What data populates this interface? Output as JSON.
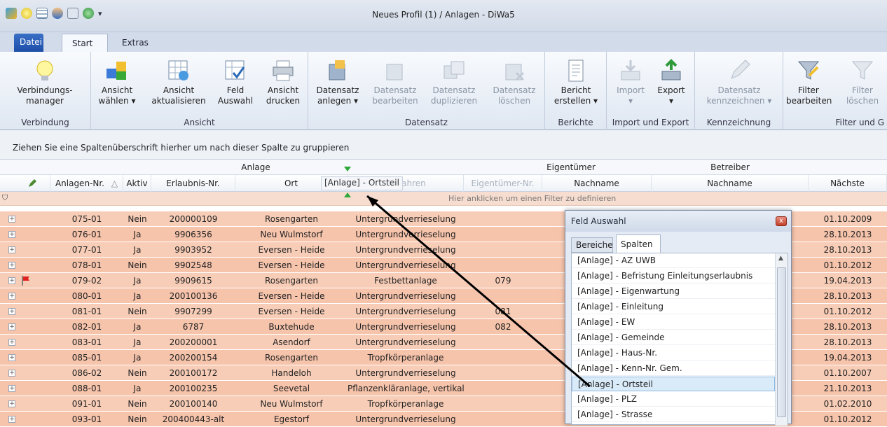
{
  "window": {
    "title": "Neues Profil (1) / Anlagen - DiWa5"
  },
  "tabs": {
    "datei": "Datei",
    "start": "Start",
    "extras": "Extras"
  },
  "ribbon": {
    "verbindung": {
      "label": "Verbindung",
      "btn": "Verbindungs-\nmanager"
    },
    "ansicht": {
      "label": "Ansicht",
      "waehlen": "Ansicht\nwählen ▾",
      "aktualisieren": "Ansicht\naktualisieren",
      "feld": "Feld\nAuswahl",
      "drucken": "Ansicht\ndrucken"
    },
    "datensatz": {
      "label": "Datensatz",
      "anlegen": "Datensatz\nanlegen ▾",
      "bearbeiten": "Datensatz\nbearbeiten",
      "duplizieren": "Datensatz\nduplizieren",
      "loeschen": "Datensatz\nlöschen"
    },
    "berichte": {
      "label": "Berichte",
      "erstellen": "Bericht\nerstellen ▾"
    },
    "importexport": {
      "label": "Import und Export",
      "import": "Import\n▾",
      "export": "Export\n▾"
    },
    "kennzeichnung": {
      "label": "Kennzeichnung",
      "btn": "Datensatz\nkennzeichnen ▾"
    },
    "filter": {
      "label": "Filter und G",
      "bearbeiten": "Filter\nbearbeiten",
      "loeschen": "Filter\nlöschen"
    }
  },
  "groupbar": {
    "hint": "Ziehen Sie eine Spaltenüberschrift hierher um nach dieser Spalte zu gruppieren"
  },
  "grid": {
    "bands": {
      "anlage": "Anlage",
      "eigentuemer": "Eigentümer",
      "betreiber": "Betreiber"
    },
    "headers": {
      "anlagen_nr": "Anlagen-Nr.",
      "sort": "△",
      "aktiv": "Aktiv",
      "erlaubnis": "Erlaubnis-Nr.",
      "ort": "Ort",
      "verfahren": "Verfahren",
      "eigentuemer_nr": "Eigentümer-Nr.",
      "nachname1": "Nachname",
      "nachname2": "Nachname",
      "naechste": "Nächste"
    },
    "filter_hint": "Hier anklicken um einen Filter zu definieren",
    "drag_label": "[Anlage] - Ortsteil",
    "rows": [
      {
        "nr": "075-01",
        "aktiv": "Nein",
        "erlaubnis": "200000109",
        "ort": "Rosengarten",
        "verfahren": "Untergrundverrieselung",
        "eig": "",
        "date": "01.10.2009"
      },
      {
        "nr": "076-01",
        "aktiv": "Ja",
        "erlaubnis": "9906356",
        "ort": "Neu Wulmstorf",
        "verfahren": "Untergrundverrieselung",
        "eig": "",
        "date": "28.10.2013"
      },
      {
        "nr": "077-01",
        "aktiv": "Ja",
        "erlaubnis": "9903952",
        "ort": "Eversen - Heide",
        "verfahren": "Untergrundverrieselung",
        "eig": "",
        "date": "28.10.2013"
      },
      {
        "nr": "078-01",
        "aktiv": "Nein",
        "erlaubnis": "9902548",
        "ort": "Eversen - Heide",
        "verfahren": "Untergrundverrieselung",
        "eig": "",
        "date": "01.10.2012"
      },
      {
        "nr": "079-02",
        "aktiv": "Ja",
        "erlaubnis": "9909615",
        "ort": "Rosengarten",
        "verfahren": "Festbettanlage",
        "eig": "079",
        "date": "19.04.2013"
      },
      {
        "nr": "080-01",
        "aktiv": "Ja",
        "erlaubnis": "200100136",
        "ort": "Eversen - Heide",
        "verfahren": "Untergrundverrieselung",
        "eig": "",
        "date": "28.10.2013"
      },
      {
        "nr": "081-01",
        "aktiv": "Nein",
        "erlaubnis": "9907299",
        "ort": "Eversen - Heide",
        "verfahren": "Untergrundverrieselung",
        "eig": "081",
        "date": "01.10.2012"
      },
      {
        "nr": "082-01",
        "aktiv": "Ja",
        "erlaubnis": "6787",
        "ort": "Buxtehude",
        "verfahren": "Untergrundverrieselung",
        "eig": "082",
        "date": "28.10.2013"
      },
      {
        "nr": "083-01",
        "aktiv": "Ja",
        "erlaubnis": "200200001",
        "ort": "Asendorf",
        "verfahren": "Untergrundverrieselung",
        "eig": "",
        "date": "28.10.2013"
      },
      {
        "nr": "085-01",
        "aktiv": "Ja",
        "erlaubnis": "200200154",
        "ort": "Rosengarten",
        "verfahren": "Tropfkörperanlage",
        "eig": "",
        "date": "19.04.2013"
      },
      {
        "nr": "086-02",
        "aktiv": "Nein",
        "erlaubnis": "200100172",
        "ort": "Handeloh",
        "verfahren": "Untergrundverrieselung",
        "eig": "",
        "date": "01.10.2007"
      },
      {
        "nr": "088-01",
        "aktiv": "Ja",
        "erlaubnis": "200100235",
        "ort": "Seevetal",
        "verfahren": "Pflanzenkläranlage, vertikal",
        "eig": "",
        "date": "21.10.2013"
      },
      {
        "nr": "091-01",
        "aktiv": "Nein",
        "erlaubnis": "200100140",
        "ort": "Neu Wulmstorf",
        "verfahren": "Tropfkörperanlage",
        "eig": "",
        "date": "01.02.2010"
      },
      {
        "nr": "093-01",
        "aktiv": "Nein",
        "erlaubnis": "200400443-alt",
        "ort": "Egestorf",
        "verfahren": "Untergrundverrieselung",
        "eig": "",
        "date": "01.10.2012"
      }
    ]
  },
  "dialog": {
    "title": "Feld Auswahl",
    "close": "x",
    "tab_bereiche": "Bereiche",
    "tab_spalten": "Spalten",
    "items": [
      "[Anlage] - AZ UWB",
      "[Anlage] - Befristung Einleitungserlaubnis",
      "[Anlage] - Eigenwartung",
      "[Anlage] - Einleitung",
      "[Anlage] - EW",
      "[Anlage] - Gemeinde",
      "[Anlage] - Haus-Nr.",
      "[Anlage] - Kenn-Nr. Gem.",
      "[Anlage] - Ortsteil",
      "[Anlage] - PLZ",
      "[Anlage] - Strasse"
    ],
    "selected_index": 8
  },
  "colors": {
    "row": "#f8cdb7",
    "row_alt": "#f6c3ab",
    "accent": "#1d4fa8"
  }
}
